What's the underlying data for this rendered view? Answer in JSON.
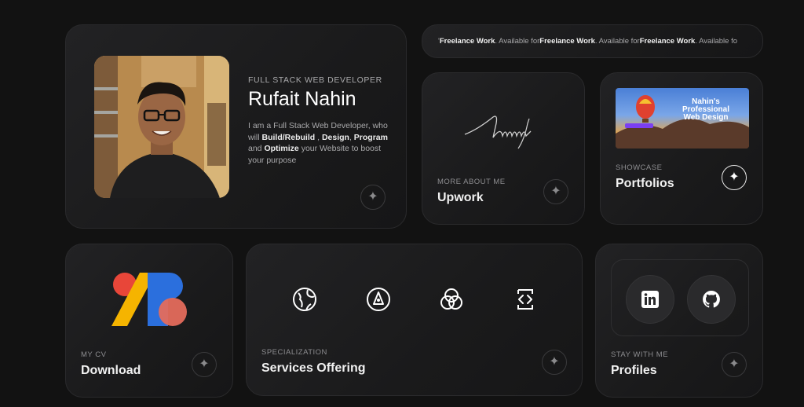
{
  "hero": {
    "role": "FULL STACK WEB DEVELOPER",
    "name": "Rufait Nahin",
    "bio": {
      "t1": "I am a Full Stack Web Developer, who will ",
      "b1": "Build/Rebuild",
      "t2": " , ",
      "b2": "Design",
      "t3": ", ",
      "b3": "Program",
      "t4": " and ",
      "b4": "Optimize",
      "t5": " your Website to boost your purpose"
    }
  },
  "ticker": {
    "lead": "'",
    "bold": "Freelance Work",
    "sep": " . Available for ",
    "tail": " . Available fo"
  },
  "upwork": {
    "eyebrow": "MORE ABOUT ME",
    "title": "Upwork"
  },
  "portfolios": {
    "eyebrow": "SHOWCASE",
    "title": "Portfolios",
    "thumb_line1": "Nahin's",
    "thumb_line2": "Professional",
    "thumb_line3": "Web Design"
  },
  "cv": {
    "eyebrow": "MY CV",
    "title": "Download"
  },
  "services": {
    "eyebrow": "SPECIALIZATION",
    "title": "Services Offering",
    "icons": [
      "globe-icon",
      "pen-nib-icon",
      "color-circles-icon",
      "code-icon"
    ]
  },
  "profiles": {
    "eyebrow": "STAY WITH ME",
    "title": "Profiles",
    "icons": [
      "linkedin-icon",
      "github-icon"
    ]
  },
  "colors": {
    "background": "#121212",
    "card": "#1c1c1d",
    "logo_red": "#e84639",
    "logo_yellow": "#f5b400",
    "logo_blue": "#2b6fdd"
  }
}
